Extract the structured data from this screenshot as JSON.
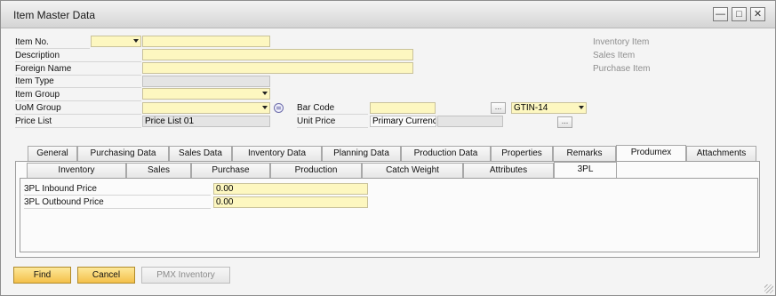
{
  "window": {
    "title": "Item Master Data",
    "controls": {
      "minimize_icon": "minimize-icon",
      "maximize_icon": "maximize-icon",
      "close_icon": "close-icon"
    }
  },
  "header": {
    "item_no": {
      "label": "Item No.",
      "series_value": "",
      "value": ""
    },
    "description": {
      "label": "Description",
      "value": ""
    },
    "foreign_name": {
      "label": "Foreign Name",
      "value": ""
    },
    "item_type": {
      "label": "Item Type",
      "value": ""
    },
    "item_group": {
      "label": "Item Group",
      "value": ""
    },
    "uom_group": {
      "label": "UoM Group",
      "value": ""
    },
    "price_list": {
      "label": "Price List",
      "value": "Price List 01"
    },
    "bar_code": {
      "label": "Bar Code",
      "value": "",
      "button": "...",
      "type_value": "GTIN-14"
    },
    "unit_price": {
      "label": "Unit Price",
      "currency": "Primary Currenc",
      "value": "",
      "button": "..."
    },
    "checkboxes": [
      {
        "label": "Inventory Item"
      },
      {
        "label": "Sales Item"
      },
      {
        "label": "Purchase Item"
      }
    ]
  },
  "tabs": [
    "General",
    "Purchasing Data",
    "Sales Data",
    "Inventory Data",
    "Planning Data",
    "Production Data",
    "Properties",
    "Remarks",
    "Produmex",
    "Attachments"
  ],
  "active_tab": "Produmex",
  "subtabs": [
    "Inventory",
    "Sales",
    "Purchase",
    "Production",
    "Catch Weight",
    "Attributes",
    "3PL"
  ],
  "active_subtab": "3PL",
  "threepl": {
    "inbound": {
      "label": "3PL Inbound Price",
      "value": "0.00"
    },
    "outbound": {
      "label": "3PL Outbound Price",
      "value": "0.00"
    }
  },
  "footer": {
    "find": "Find",
    "cancel": "Cancel",
    "pmx_inventory": "PMX Inventory"
  },
  "colors": {
    "field_yellow": "#fdf7c0",
    "button_gold": "#f4c04a",
    "title_bar": "#e4e4e4"
  }
}
